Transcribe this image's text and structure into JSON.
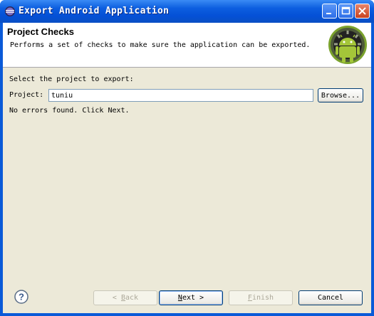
{
  "window": {
    "title": "Export Android Application"
  },
  "header": {
    "title": "Project Checks",
    "description": "Performs a set of checks to make sure the application can be exported."
  },
  "form": {
    "select_label": "Select the project to export:",
    "project_label": "Project:",
    "project_value": "tuniu",
    "browse_label": "Browse...",
    "status": "No errors found. Click Next."
  },
  "buttons": {
    "back": {
      "mn": "B",
      "rest": "ack",
      "prefix": "< "
    },
    "next": {
      "mn": "N",
      "rest": "ext >"
    },
    "finish": {
      "mn": "F",
      "rest": "inish"
    },
    "cancel": "Cancel"
  },
  "icons": {
    "app": "eclipse-icon",
    "logo": "android-logo",
    "help": "help-icon"
  },
  "colors": {
    "titlebar": "#0a5ad8",
    "dialog_bg": "#ece9d8",
    "android_green": "#a4c639"
  }
}
